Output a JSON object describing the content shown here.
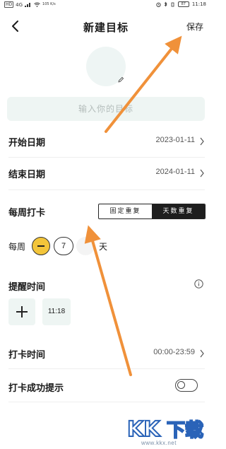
{
  "status_bar": {
    "carrier_badge": "HD",
    "signal": "4G",
    "speed": "105\nK/s",
    "battery": "87",
    "time": "11:18"
  },
  "header": {
    "title": "新建目标",
    "save_label": "保存"
  },
  "goal_input": {
    "placeholder": "输入你的目标"
  },
  "rows": {
    "start_date": {
      "label": "开始日期",
      "value": "2023-01-11"
    },
    "end_date": {
      "label": "结束日期",
      "value": "2024-01-11"
    },
    "weekly_checkin": {
      "label": "每周打卡"
    },
    "checkin_time": {
      "label": "打卡时间",
      "value": "00:00-23:59"
    },
    "success_tip": {
      "label": "打卡成功提示"
    }
  },
  "repeat_mode": {
    "options": [
      "固定重复",
      "天数重复"
    ],
    "selected": "天数重复"
  },
  "weekly_days": {
    "prefix": "每周",
    "count": "7",
    "suffix": "天"
  },
  "reminder": {
    "label": "提醒时间",
    "time": "11:18"
  },
  "watermark": {
    "logo_text": "KK下载",
    "url": "www.kkx.net"
  },
  "colors": {
    "accent_yellow": "#f3c53a",
    "input_bg": "#eef5f3",
    "annotation_arrow": "#f0913a"
  }
}
